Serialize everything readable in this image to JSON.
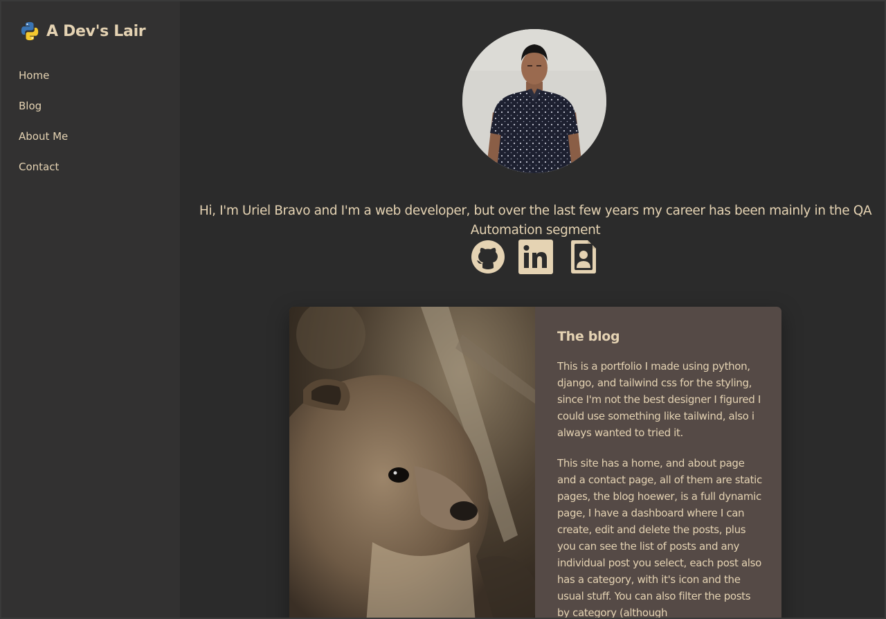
{
  "sidebar": {
    "brand_title": "A Dev's Lair",
    "brand_icon": "python-logo-icon",
    "nav": [
      {
        "label": "Home"
      },
      {
        "label": "Blog"
      },
      {
        "label": "About Me"
      },
      {
        "label": "Contact"
      }
    ]
  },
  "profile": {
    "intro": "Hi, I'm Uriel Bravo and I'm a web developer, but over the last few years my career has been mainly in the QA Automation segment",
    "socials": [
      {
        "icon": "github-icon"
      },
      {
        "icon": "linkedin-icon"
      },
      {
        "icon": "resume-icon"
      }
    ]
  },
  "card": {
    "title": "The blog",
    "paragraphs": [
      "This is a portfolio I made using python, django, and tailwind css for the styling, since I'm not the best designer I figured I could use something like tailwind, also i always wanted to tried it.",
      "This site has a home, and about page and a contact page, all of them are static pages, the blog hoewer, is a full dynamic page, I have a dashboard where I can create, edit and delete the posts, plus you can see the list of posts and any individual post you select, each post also has a category, with it's icon and the usual stuff. You can also filter the posts by category (although"
    ]
  },
  "colors": {
    "accent_text": "#e5d3b3",
    "sidebar_bg": "#323131",
    "main_bg": "#2b2b2b",
    "card_bg": "#554a46"
  }
}
